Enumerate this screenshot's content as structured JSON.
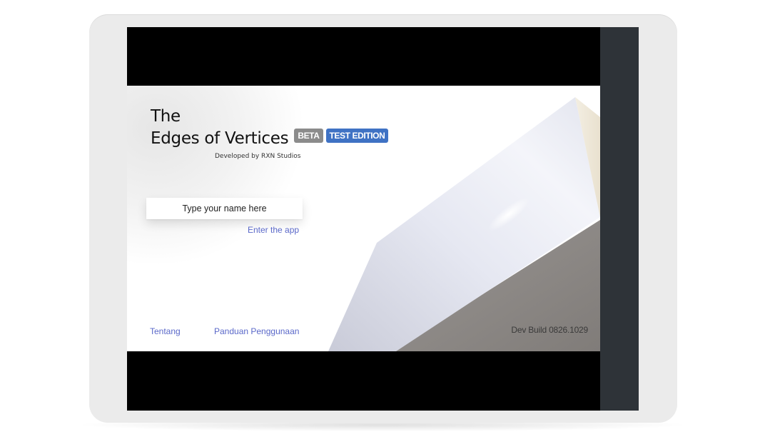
{
  "app": {
    "title_line1": "The",
    "title_line2": "Edges of Vertices",
    "badges": {
      "beta": "BETA",
      "test_edition": "TEST EDITION"
    },
    "developer": "Developed by RXN Studios",
    "name_input": {
      "placeholder": "Type your name here",
      "value": ""
    },
    "enter_link": "Enter the app",
    "footer": {
      "about": "Tentang",
      "guide": "Panduan Penggunaan",
      "build": "Dev Build 0826.1029"
    }
  },
  "colors": {
    "link": "#5a68c9",
    "badge_beta": "#8b8b8b",
    "badge_test": "#3f72c4",
    "sidebar": "#2e3338",
    "device_frame": "#ebebeb"
  }
}
